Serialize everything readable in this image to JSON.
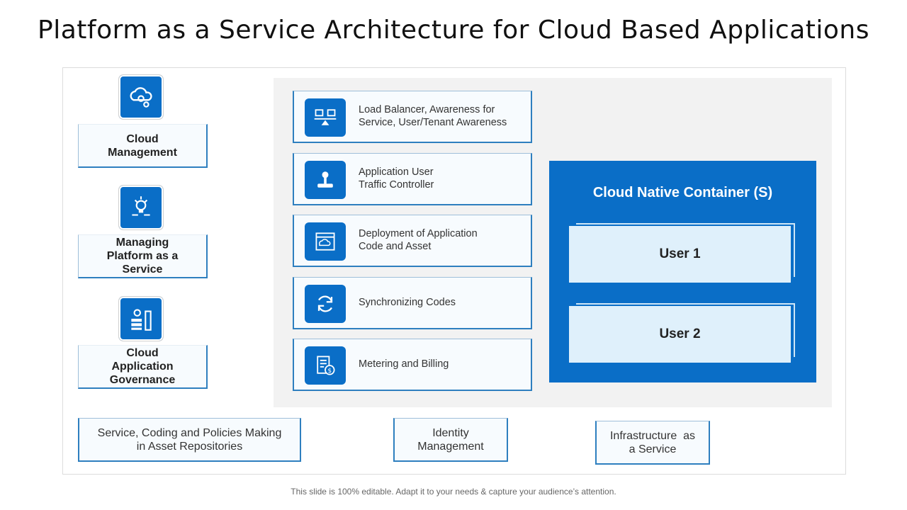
{
  "title": "Platform as a Service Architecture for Cloud Based Applications",
  "left_items": [
    {
      "label": "Cloud\nManagement",
      "icon": "cloud-gear-icon"
    },
    {
      "label": "Managing\nPlatform as a\nService",
      "icon": "bulb-gear-icon"
    },
    {
      "label": "Cloud\nApplication\nGovernance",
      "icon": "server-gear-icon"
    }
  ],
  "middle_items": [
    {
      "label": "Load Balancer, Awareness for\nService, User/Tenant Awareness",
      "icon": "balance-icon"
    },
    {
      "label": "Application User\nTraffic Controller",
      "icon": "joystick-icon"
    },
    {
      "label": "Deployment of Application\nCode and Asset",
      "icon": "deploy-icon"
    },
    {
      "label": "Synchronizing Codes",
      "icon": "sync-icon"
    },
    {
      "label": "Metering and Billing",
      "icon": "billing-icon"
    }
  ],
  "container": {
    "title": "Cloud Native Container (S)",
    "users": [
      "User 1",
      "User 2"
    ]
  },
  "bottom_items": [
    "Service, Coding and Policies Making\nin Asset Repositories",
    "Identity\nManagement",
    "Infrastructure  as\na Service"
  ],
  "footer": "This slide is 100% editable. Adapt it to your needs & capture your audience’s attention.",
  "colors": {
    "accent": "#0a6ec7",
    "panel": "#f2f2f2",
    "user_box": "#dff0fb"
  }
}
